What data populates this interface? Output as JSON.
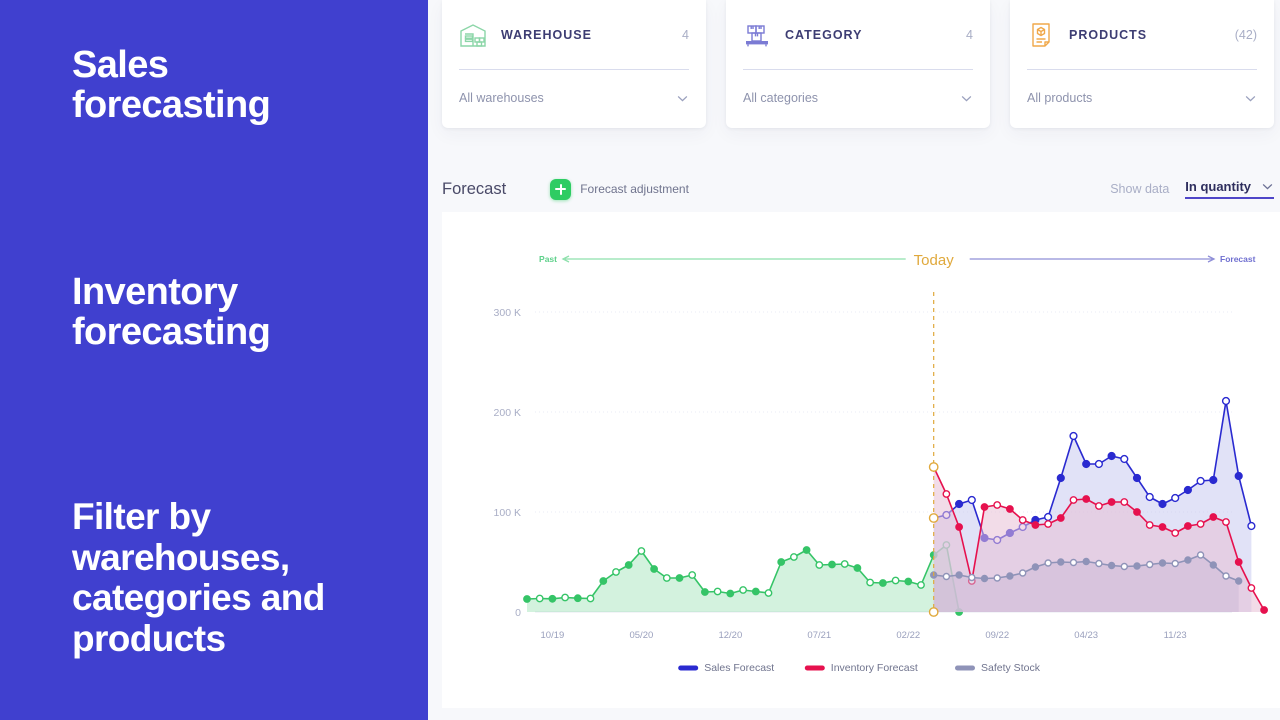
{
  "promo": {
    "blocks": [
      "Sales\nforecasting",
      "Inventory\nforecasting",
      "Filter by\nwarehouses,\ncategories and\nproducts"
    ],
    "bg_color": "#4040cf"
  },
  "filters": [
    {
      "title": "WAREHOUSE",
      "count": "4",
      "selected": "All warehouses",
      "icon": "warehouse-icon",
      "icon_color": "#8cd6a8"
    },
    {
      "title": "CATEGORY",
      "count": "4",
      "selected": "All categories",
      "icon": "boxes-pallet-icon",
      "icon_color": "#7b7bd4"
    },
    {
      "title": "PRODUCTS",
      "count": "(42)",
      "selected": "All products",
      "icon": "product-document-icon",
      "icon_color": "#f0a84a"
    }
  ],
  "forecast_header": {
    "title": "Forecast",
    "adjust_label": "Forecast adjustment",
    "adjust_icon": "plus-icon",
    "show_data_label": "Show data",
    "unit_selected": "In quantity",
    "unit_chevron": "chevron-down-icon"
  },
  "chart_data": {
    "type": "line",
    "title": "Forecast",
    "xlabel": "",
    "ylabel": "",
    "ylim": [
      0,
      330000
    ],
    "yticks": [
      0,
      100000,
      200000,
      300000
    ],
    "ytick_labels": [
      "0",
      "100 K",
      "200 K",
      "300 K"
    ],
    "grid": true,
    "legend_position": "bottom",
    "xtick_labels": [
      "10/19",
      "05/20",
      "12/20",
      "07/21",
      "02/22",
      "09/22",
      "04/23",
      "11/23"
    ],
    "xtick_index": [
      2,
      9,
      16,
      23,
      30,
      37,
      44,
      51
    ],
    "annotations": {
      "past_label": "Past",
      "past_color": "#5fd18b",
      "today_label": "Today",
      "today_color": "#e0a93c",
      "today_index": 32,
      "forecast_label": "Forecast",
      "forecast_color": "#6f6fd0"
    },
    "x_count": 56,
    "legend": [
      {
        "name": "Sales Forecast",
        "color": "#2a2ad0"
      },
      {
        "name": "Inventory Forecast",
        "color": "#e6114e"
      },
      {
        "name": "Safety Stock",
        "color": "#8f93b8"
      }
    ],
    "series": [
      {
        "name": "Past Sales",
        "color": "#35c467",
        "fill": "#35c467",
        "from_index": 0,
        "values": [
          13000,
          13500,
          13200,
          14500,
          13800,
          13500,
          31000,
          40000,
          47000,
          61000,
          43000,
          34000,
          34000,
          37000,
          20000,
          20500,
          18500,
          22000,
          20500,
          19000,
          50000,
          55000,
          62000,
          47000,
          47500,
          48000,
          44000,
          29500,
          29000,
          31500,
          30500,
          27000,
          57000,
          67000,
          0
        ]
      },
      {
        "name": "Sales Forecast",
        "color": "#2a2ad0",
        "fill": "#c3c5ef",
        "from_index": 32,
        "values": [
          94000,
          97000,
          108000,
          112000,
          74000,
          72000,
          79000,
          85000,
          92000,
          95000,
          134000,
          176000,
          148000,
          148000,
          156000,
          153000,
          134000,
          115000,
          108000,
          114000,
          122000,
          131000,
          132000,
          211000,
          136000,
          86000
        ]
      },
      {
        "name": "Inventory Forecast",
        "color": "#e6114e",
        "fill": "#e7bfd5",
        "from_index": 32,
        "values": [
          145000,
          118000,
          85000,
          31000,
          105000,
          107000,
          103000,
          92000,
          87000,
          88000,
          94000,
          112000,
          113000,
          106000,
          110000,
          110000,
          100000,
          87000,
          85000,
          79000,
          86000,
          88000,
          95000,
          90000,
          50000,
          24000,
          2000
        ]
      },
      {
        "name": "Safety Stock",
        "color": "#8f93b8",
        "fill": "#cbb9d6",
        "from_index": 32,
        "values": [
          37000,
          35500,
          37000,
          34500,
          33500,
          34000,
          36000,
          39000,
          45000,
          49000,
          50000,
          49500,
          50500,
          48500,
          46500,
          45500,
          46000,
          47500,
          49000,
          48500,
          52000,
          57000,
          47000,
          36000,
          31000
        ]
      }
    ]
  }
}
